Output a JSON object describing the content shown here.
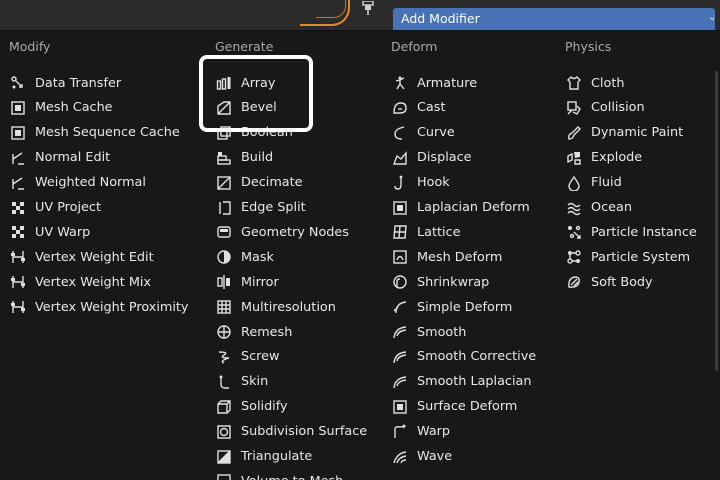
{
  "header": {
    "button_label": "Add Modifier"
  },
  "columns": [
    {
      "title": "Modify",
      "items": [
        {
          "label": "Data Transfer",
          "icon": "data-transfer-icon"
        },
        {
          "label": "Mesh Cache",
          "icon": "mesh-cache-icon"
        },
        {
          "label": "Mesh Sequence Cache",
          "icon": "mesh-sequence-cache-icon"
        },
        {
          "label": "Normal Edit",
          "icon": "normal-edit-icon"
        },
        {
          "label": "Weighted Normal",
          "icon": "weighted-normal-icon"
        },
        {
          "label": "UV Project",
          "icon": "uv-project-icon"
        },
        {
          "label": "UV Warp",
          "icon": "uv-warp-icon"
        },
        {
          "label": "Vertex Weight Edit",
          "icon": "vertex-weight-edit-icon"
        },
        {
          "label": "Vertex Weight Mix",
          "icon": "vertex-weight-mix-icon"
        },
        {
          "label": "Vertex Weight Proximity",
          "icon": "vertex-weight-proximity-icon"
        }
      ]
    },
    {
      "title": "Generate",
      "items": [
        {
          "label": "Array",
          "icon": "array-icon"
        },
        {
          "label": "Bevel",
          "icon": "bevel-icon"
        },
        {
          "label": "Boolean",
          "icon": "boolean-icon"
        },
        {
          "label": "Build",
          "icon": "build-icon"
        },
        {
          "label": "Decimate",
          "icon": "decimate-icon"
        },
        {
          "label": "Edge Split",
          "icon": "edge-split-icon"
        },
        {
          "label": "Geometry Nodes",
          "icon": "geometry-nodes-icon"
        },
        {
          "label": "Mask",
          "icon": "mask-icon"
        },
        {
          "label": "Mirror",
          "icon": "mirror-icon"
        },
        {
          "label": "Multiresolution",
          "icon": "multiresolution-icon"
        },
        {
          "label": "Remesh",
          "icon": "remesh-icon"
        },
        {
          "label": "Screw",
          "icon": "screw-icon"
        },
        {
          "label": "Skin",
          "icon": "skin-icon"
        },
        {
          "label": "Solidify",
          "icon": "solidify-icon"
        },
        {
          "label": "Subdivision Surface",
          "icon": "subdivision-surface-icon"
        },
        {
          "label": "Triangulate",
          "icon": "triangulate-icon"
        },
        {
          "label": "Volume to Mesh",
          "icon": "volume-to-mesh-icon"
        }
      ]
    },
    {
      "title": "Deform",
      "items": [
        {
          "label": "Armature",
          "icon": "armature-icon"
        },
        {
          "label": "Cast",
          "icon": "cast-icon"
        },
        {
          "label": "Curve",
          "icon": "curve-icon"
        },
        {
          "label": "Displace",
          "icon": "displace-icon"
        },
        {
          "label": "Hook",
          "icon": "hook-icon"
        },
        {
          "label": "Laplacian Deform",
          "icon": "laplacian-deform-icon"
        },
        {
          "label": "Lattice",
          "icon": "lattice-icon"
        },
        {
          "label": "Mesh Deform",
          "icon": "mesh-deform-icon"
        },
        {
          "label": "Shrinkwrap",
          "icon": "shrinkwrap-icon"
        },
        {
          "label": "Simple Deform",
          "icon": "simple-deform-icon"
        },
        {
          "label": "Smooth",
          "icon": "smooth-icon"
        },
        {
          "label": "Smooth Corrective",
          "icon": "smooth-corrective-icon"
        },
        {
          "label": "Smooth Laplacian",
          "icon": "smooth-laplacian-icon"
        },
        {
          "label": "Surface Deform",
          "icon": "surface-deform-icon"
        },
        {
          "label": "Warp",
          "icon": "warp-icon"
        },
        {
          "label": "Wave",
          "icon": "wave-icon"
        }
      ]
    },
    {
      "title": "Physics",
      "items": [
        {
          "label": "Cloth",
          "icon": "cloth-icon"
        },
        {
          "label": "Collision",
          "icon": "collision-icon"
        },
        {
          "label": "Dynamic Paint",
          "icon": "dynamic-paint-icon"
        },
        {
          "label": "Explode",
          "icon": "explode-icon"
        },
        {
          "label": "Fluid",
          "icon": "fluid-icon"
        },
        {
          "label": "Ocean",
          "icon": "ocean-icon"
        },
        {
          "label": "Particle Instance",
          "icon": "particle-instance-icon"
        },
        {
          "label": "Particle System",
          "icon": "particle-system-icon"
        },
        {
          "label": "Soft Body",
          "icon": "soft-body-icon"
        }
      ]
    }
  ],
  "colors": {
    "accent": "#4772b3",
    "menu_bg": "#181818",
    "text": "#e8e8e8",
    "header_text": "#a8a8a8",
    "annotation": "#ffffff"
  }
}
